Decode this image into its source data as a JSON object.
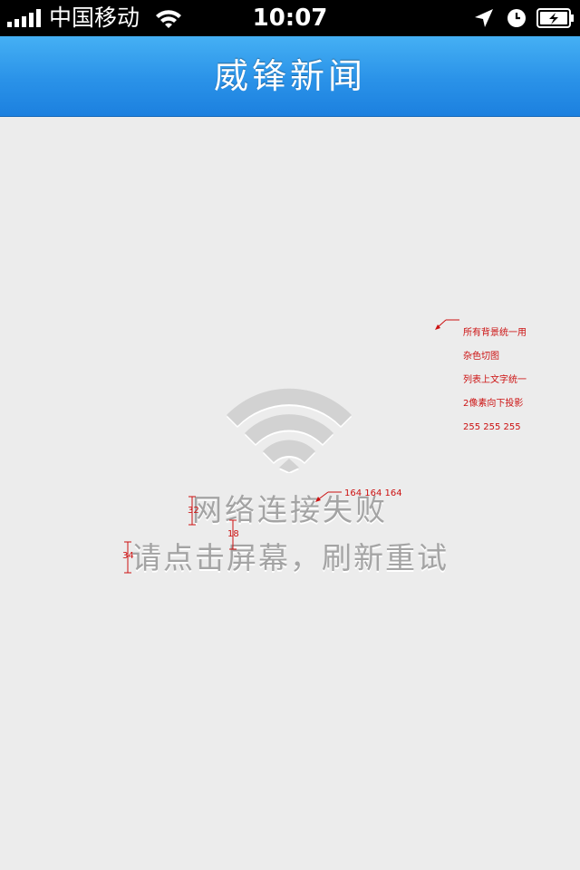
{
  "status_bar": {
    "carrier": "中国移动",
    "time": "10:07",
    "icons": [
      "signal-bars-icon",
      "wifi-icon",
      "location-arrow-icon",
      "alarm-clock-icon",
      "battery-charging-icon"
    ]
  },
  "nav_bar": {
    "title": "威锋新闻",
    "colors": {
      "top": "#45b0f4",
      "bottom": "#1c80df"
    }
  },
  "content": {
    "background": "#ececec",
    "icon": "wifi-icon",
    "error_line1": "网络连接失败",
    "error_line2": "请点击屏幕，刷新重试",
    "text_color": "#a4a4a4"
  },
  "annotations": {
    "note_lines": [
      "所有背景统一用",
      "杂色切图",
      "列表上文字统一",
      "2像素向下投影",
      "255 255 255"
    ],
    "text_color_value": "164  164  164",
    "dim_line1_height": "32",
    "dim_gap": "18",
    "dim_line2_height": "34",
    "color": "#cc1111"
  }
}
